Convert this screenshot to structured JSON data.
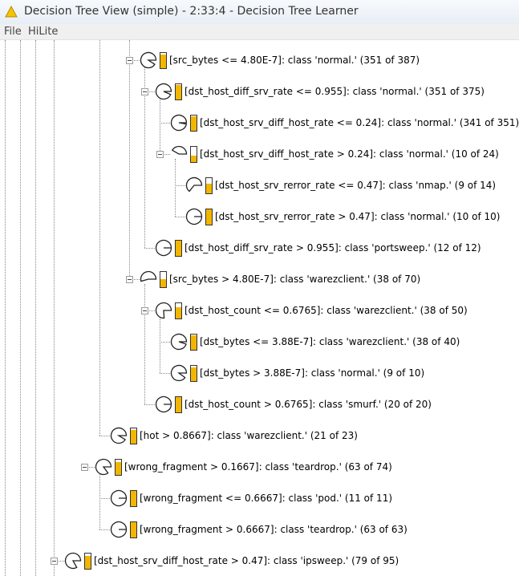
{
  "window": {
    "title": "Decision Tree View (simple) - 2:33:4 - Decision Tree Learner",
    "icon": "warning-triangle-icon"
  },
  "menu": {
    "file": "File",
    "hilite": "HiLite"
  },
  "colors": {
    "fill": "#f2b600",
    "border": "#333333"
  },
  "tree": {
    "nodes": [
      {
        "label": "[src_bytes <= 4.80E-7]:  class 'normal.' (351 of 387)",
        "depth": 4,
        "toggle": true,
        "fraction": 0.907
      },
      {
        "label": "[dst_host_diff_srv_rate <= 0.955]:  class 'normal.' (351 of 375)",
        "depth": 5,
        "toggle": true,
        "fraction": 0.936
      },
      {
        "label": "[dst_host_srv_diff_host_rate <= 0.24]:  class 'normal.' (341 of 351)",
        "depth": 6,
        "toggle": false,
        "fraction": 0.972
      },
      {
        "label": "[dst_host_srv_diff_host_rate > 0.24]:  class 'normal.' (10 of 24)",
        "depth": 6,
        "toggle": true,
        "fraction": 0.417
      },
      {
        "label": "[dst_host_srv_rerror_rate <= 0.47]:  class 'nmap.' (9 of 14)",
        "depth": 7,
        "toggle": false,
        "fraction": 0.643
      },
      {
        "label": "[dst_host_srv_rerror_rate > 0.47]:  class 'normal.' (10 of 10)",
        "depth": 7,
        "toggle": false,
        "fraction": 1.0
      },
      {
        "label": "[dst_host_diff_srv_rate > 0.955]:  class 'portsweep.' (12 of 12)",
        "depth": 5,
        "toggle": false,
        "fraction": 1.0
      },
      {
        "label": "[src_bytes > 4.80E-7]:  class 'warezclient.' (38 of 70)",
        "depth": 4,
        "toggle": true,
        "fraction": 0.543
      },
      {
        "label": "[dst_host_count <= 0.6765]:  class 'warezclient.' (38 of 50)",
        "depth": 5,
        "toggle": true,
        "fraction": 0.76
      },
      {
        "label": "[dst_bytes <= 3.88E-7]:  class 'warezclient.' (38 of 40)",
        "depth": 6,
        "toggle": false,
        "fraction": 0.95
      },
      {
        "label": "[dst_bytes > 3.88E-7]:  class 'normal.' (9 of 10)",
        "depth": 6,
        "toggle": false,
        "fraction": 0.9
      },
      {
        "label": "[dst_host_count > 0.6765]:  class 'smurf.' (20 of 20)",
        "depth": 5,
        "toggle": false,
        "fraction": 1.0
      },
      {
        "label": "[hot > 0.8667]:  class 'warezclient.' (21 of 23)",
        "depth": 3,
        "toggle": false,
        "fraction": 0.913
      },
      {
        "label": "[wrong_fragment > 0.1667]:  class 'teardrop.' (63 of 74)",
        "depth": 2,
        "toggle": true,
        "fraction": 0.851
      },
      {
        "label": "[wrong_fragment <= 0.6667]:  class 'pod.' (11 of 11)",
        "depth": 3,
        "toggle": false,
        "fraction": 1.0
      },
      {
        "label": "[wrong_fragment > 0.6667]:  class 'teardrop.' (63 of 63)",
        "depth": 3,
        "toggle": false,
        "fraction": 1.0
      },
      {
        "label": "[dst_host_srv_diff_host_rate > 0.47]:  class 'ipsweep.' (79 of 95)",
        "depth": 1,
        "toggle": true,
        "fraction": 0.832
      }
    ]
  }
}
